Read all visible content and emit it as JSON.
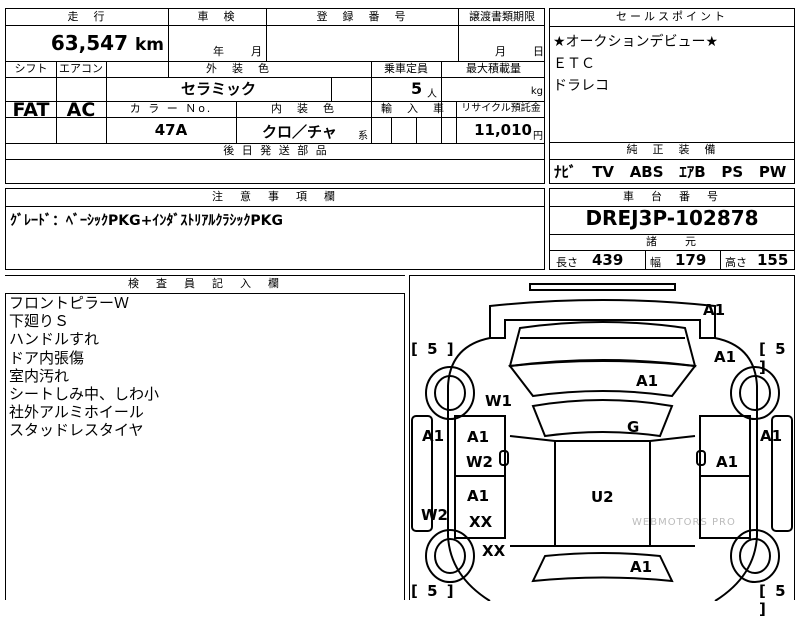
{
  "header_row": {
    "mileage_label": "走　行",
    "inspection_label": "車　検",
    "registration_label": "登　録　番　号",
    "transfer_label": "譲渡書類期限",
    "selling_points_label": "セールスポイント"
  },
  "mileage": {
    "value": "63,547",
    "unit": "km"
  },
  "inspection": {
    "year_unit": "年",
    "month_unit": "月"
  },
  "transfer": {
    "month_unit": "月",
    "day_unit": "日"
  },
  "row2": {
    "shift_label": "シフト",
    "aircon_label": "エアコン",
    "exterior_color_label": "外　装　色",
    "capacity_label": "乗車定員",
    "max_load_label": "最大積載量"
  },
  "shift": "FAT",
  "aircon": "AC",
  "exterior_color": "セラミック",
  "capacity": {
    "value": "5",
    "unit": "人"
  },
  "max_load": {
    "unit": "kg"
  },
  "row3": {
    "color_no_label": "カ ラ ー Ｎo.",
    "interior_label": "内　装　色",
    "import_label": "輸　入　車",
    "recycle_label": "リサイクル預託金"
  },
  "color_no": "47A",
  "interior": {
    "value": "クロ／チャ",
    "suffix": "系"
  },
  "recycle": {
    "value": "11,010",
    "unit": "円"
  },
  "later_parts_label": "後 日 発 送 部 品",
  "selling_points": [
    "★オークションデビュー★",
    "ＥＴＣ",
    "ドラレコ"
  ],
  "standard_equipment": {
    "label": "純　正　装　備",
    "items": [
      "ﾅﾋﾞ",
      "TV",
      "ABS",
      "ｴｱB",
      "PS",
      "PW"
    ]
  },
  "notes": {
    "label": "注　意　事　項　欄",
    "text": "ｸﾞﾚｰﾄﾞ：ﾍﾞｰｼｯｸPKG+ｲﾝﾀﾞｽﾄﾘｱﾙｸﾗｼｯｸPKG"
  },
  "chassis": {
    "label": "車　台　番　号",
    "value": "DREJ3P-102878"
  },
  "specs": {
    "label": "諸　　元",
    "length_label": "長さ",
    "length": "439",
    "width_label": "幅",
    "width": "179",
    "height_label": "高さ",
    "height": "155"
  },
  "inspector": {
    "label": "検　査　員　記　入　欄",
    "lines": [
      "フロントピラーＷ",
      "下廻りＳ",
      "ハンドルすれ",
      "ドア内張傷",
      "室内汚れ",
      "シートしみ中、しわ小",
      "社外アルミホイール",
      "スタッドレスタイヤ"
    ]
  },
  "diagram": {
    "marks": {
      "front_bumper": "A1",
      "right_front_fender": "A1",
      "hood": "A1",
      "left_front_fender": "W1",
      "windshield": "G",
      "left_front_door_a": "A1",
      "left_front_door_b": "W2",
      "right_front_door": "A1",
      "left_side_far": "A1",
      "right_side_far": "A1",
      "left_rear_door_a": "A1",
      "left_rear_door_b": "XX",
      "roof": "U2",
      "left_rocker": "W2",
      "left_rear_fender": "XX",
      "trunk": "A1"
    },
    "tire_fl": "5",
    "tire_fr": "5",
    "tire_rl": "5",
    "tire_rr": "5",
    "watermark": "WEBMOTORS PRO"
  }
}
